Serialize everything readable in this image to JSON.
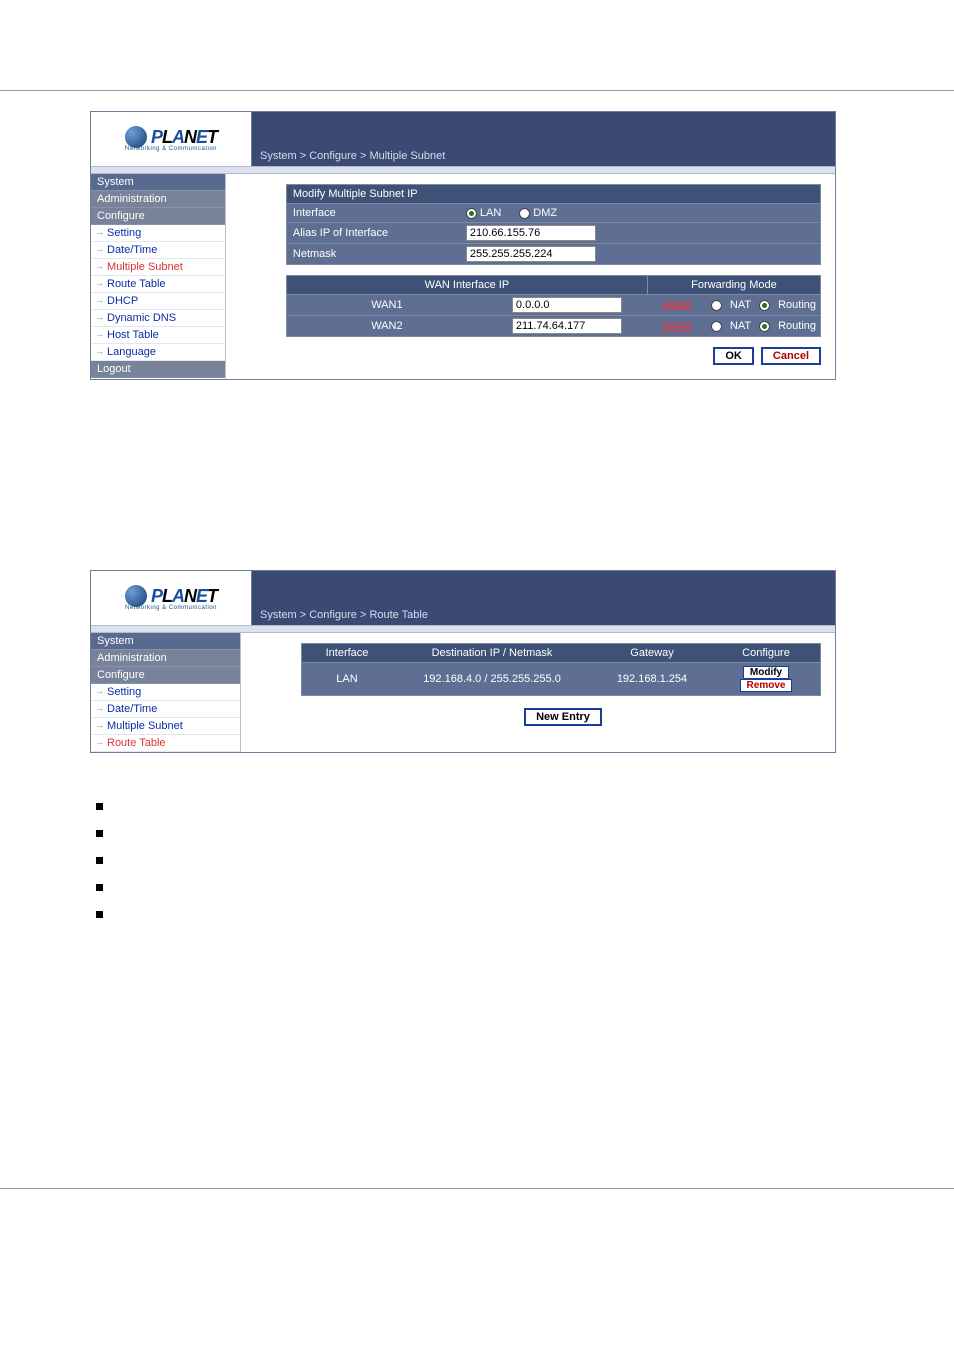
{
  "logo": {
    "brand": "PLANET",
    "tagline": "Networking & Communication"
  },
  "shot1": {
    "breadcrumb": "System > Configure > Multiple Subnet",
    "nav": {
      "system": "System",
      "administration": "Administration",
      "configure": "Configure",
      "items": [
        "Setting",
        "Date/Time",
        "Multiple Subnet",
        "Route Table",
        "DHCP",
        "Dynamic DNS",
        "Host Table",
        "Language"
      ],
      "logout": "Logout"
    },
    "panel": {
      "title": "Modify Multiple Subnet IP",
      "row1_label": "Interface",
      "row1_opt_lan": "LAN",
      "row1_opt_dmz": "DMZ",
      "row2_label": "Alias IP of Interface",
      "row2_value": "210.66.155.76",
      "row3_label": "Netmask",
      "row3_value": "255.255.255.224"
    },
    "grid": {
      "hdr_ip": "WAN Interface IP",
      "hdr_fm": "Forwarding Mode",
      "rows": [
        {
          "iface": "WAN1",
          "ip": "0.0.0.0",
          "assist": "Assist",
          "nat": "NAT",
          "routing": "Routing",
          "sel": "routing"
        },
        {
          "iface": "WAN2",
          "ip": "211.74.64.177",
          "assist": "Assist",
          "nat": "NAT",
          "routing": "Routing",
          "sel": "routing"
        }
      ]
    },
    "buttons": {
      "ok": "OK",
      "cancel": "Cancel"
    }
  },
  "shot2": {
    "breadcrumb": "System > Configure > Route Table",
    "nav": {
      "system": "System",
      "administration": "Administration",
      "configure": "Configure",
      "items": [
        "Setting",
        "Date/Time",
        "Multiple Subnet",
        "Route Table"
      ]
    },
    "table": {
      "h1": "Interface",
      "h2": "Destination IP / Netmask",
      "h3": "Gateway",
      "h4": "Configure",
      "rows": [
        {
          "iface": "LAN",
          "dest": "192.168.4.0 / 255.255.255.0",
          "gw": "192.168.1.254",
          "modify": "Modify",
          "remove": "Remove"
        }
      ],
      "new_entry": "New Entry"
    }
  }
}
